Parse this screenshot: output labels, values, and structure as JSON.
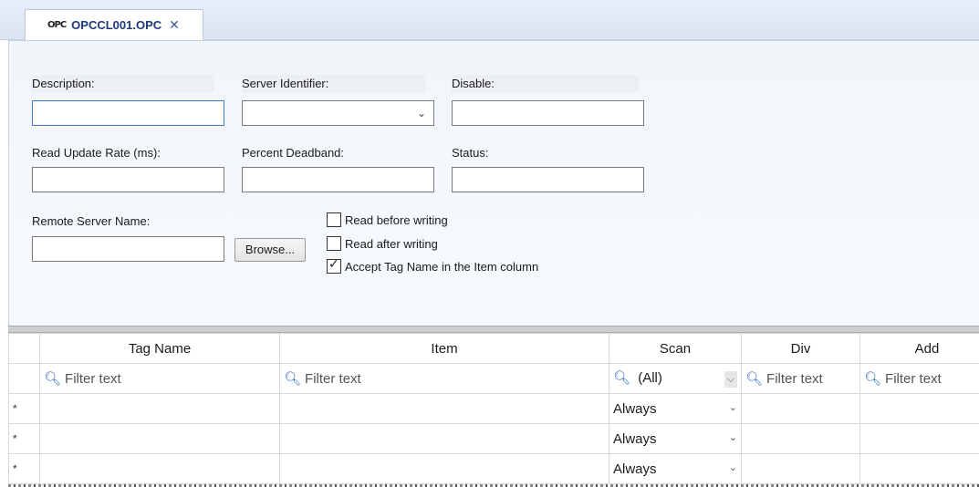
{
  "tab": {
    "icon_text": "OPC",
    "title": "OPCCL001.OPC",
    "close_glyph": "✕"
  },
  "form": {
    "description_label": "Description:",
    "description_value": "",
    "server_identifier_label": "Server Identifier:",
    "server_identifier_value": "",
    "disable_label": "Disable:",
    "disable_value": "",
    "read_update_rate_label": "Read Update Rate (ms):",
    "read_update_rate_value": "",
    "percent_deadband_label": "Percent Deadband:",
    "percent_deadband_value": "",
    "status_label": "Status:",
    "status_value": "",
    "remote_server_name_label": "Remote Server Name:",
    "remote_server_name_value": "",
    "browse_button": "Browse...",
    "read_before_writing_label": "Read before writing",
    "read_before_writing_checked": false,
    "read_after_writing_label": "Read after writing",
    "read_after_writing_checked": false,
    "accept_tag_name_label": "Accept Tag Name in the Item column",
    "accept_tag_name_checked": true
  },
  "grid": {
    "columns": [
      "Tag Name",
      "Item",
      "Scan",
      "Div",
      "Add"
    ],
    "filter_placeholder": "Filter text",
    "scan_filter_value": "(All)",
    "new_row_marker": "*",
    "rows": [
      {
        "tag_name": "",
        "item": "",
        "scan": "Always",
        "div": "",
        "add": ""
      },
      {
        "tag_name": "",
        "item": "",
        "scan": "Always",
        "div": "",
        "add": ""
      },
      {
        "tag_name": "",
        "item": "",
        "scan": "Always",
        "div": "",
        "add": ""
      }
    ]
  }
}
